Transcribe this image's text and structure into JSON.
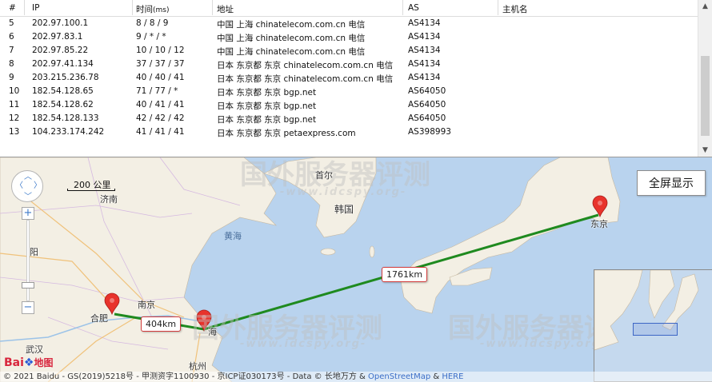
{
  "table": {
    "headers": [
      "#",
      "IP",
      "时间",
      "(ms)",
      "地址",
      "AS",
      "主机名"
    ],
    "rows": [
      {
        "hop": "5",
        "ip": "202.97.100.1",
        "time": "8 / 8 / 9",
        "location": "中国 上海 chinatelecom.com.cn 电信",
        "as": "AS4134"
      },
      {
        "hop": "6",
        "ip": "202.97.83.1",
        "time": "9 / * / *",
        "location": "中国 上海 chinatelecom.com.cn 电信",
        "as": "AS4134"
      },
      {
        "hop": "7",
        "ip": "202.97.85.22",
        "time": "10 / 10 / 12",
        "location": "中国 上海 chinatelecom.com.cn 电信",
        "as": "AS4134"
      },
      {
        "hop": "8",
        "ip": "202.97.41.134",
        "time": "37 / 37 / 37",
        "location": "日本 东京都 东京 chinatelecom.com.cn 电信",
        "as": "AS4134"
      },
      {
        "hop": "9",
        "ip": "203.215.236.78",
        "time": "40 / 40 / 41",
        "location": "日本 东京都 东京 chinatelecom.com.cn 电信",
        "as": "AS4134"
      },
      {
        "hop": "10",
        "ip": "182.54.128.65",
        "time": "71 / 77 / *",
        "location": "日本 东京都 东京 bgp.net",
        "as": "AS64050"
      },
      {
        "hop": "11",
        "ip": "182.54.128.62",
        "time": "40 / 41 / 41",
        "location": "日本 东京都 东京 bgp.net",
        "as": "AS64050"
      },
      {
        "hop": "12",
        "ip": "182.54.128.133",
        "time": "42 / 42 / 42",
        "location": "日本 东京都 东京 bgp.net",
        "as": "AS64050"
      },
      {
        "hop": "13",
        "ip": "104.233.174.242",
        "time": "41 / 41 / 41",
        "location": "日本 东京都 东京 petaexpress.com",
        "as": "AS398993"
      }
    ]
  },
  "map": {
    "fullscreen_label": "全屏显示",
    "scale_label": "200 公里",
    "distance_1": "404km",
    "distance_2": "1761km",
    "place_names": {
      "jinan": "济南",
      "beijing": "首尔",
      "korea": "韩国",
      "yellow_sea": "黄海",
      "nanjing": "南京",
      "hefei": "合肥",
      "hangzhou": "杭州",
      "wuhan": "武汉",
      "tokyo": "东京",
      "zhengzhou": "阳",
      "shanghai": "海"
    },
    "copyright_text": "© 2021 Baidu - GS(2019)5218号 - 甲测资字1100930 - 京ICP证030173号 - Data © 长地万方 & ",
    "copyright_link1": "OpenStreetMap",
    "copyright_and": " & ",
    "copyright_link2": "HERE",
    "baidu_logo_text": "Bai",
    "baidu_logo_suffix": "地图",
    "route_color": "#1f8a1f",
    "pin_color": "#e8332c"
  },
  "watermark": {
    "brand": "国外服务器评测",
    "url": "-www.idcspy.org-"
  }
}
